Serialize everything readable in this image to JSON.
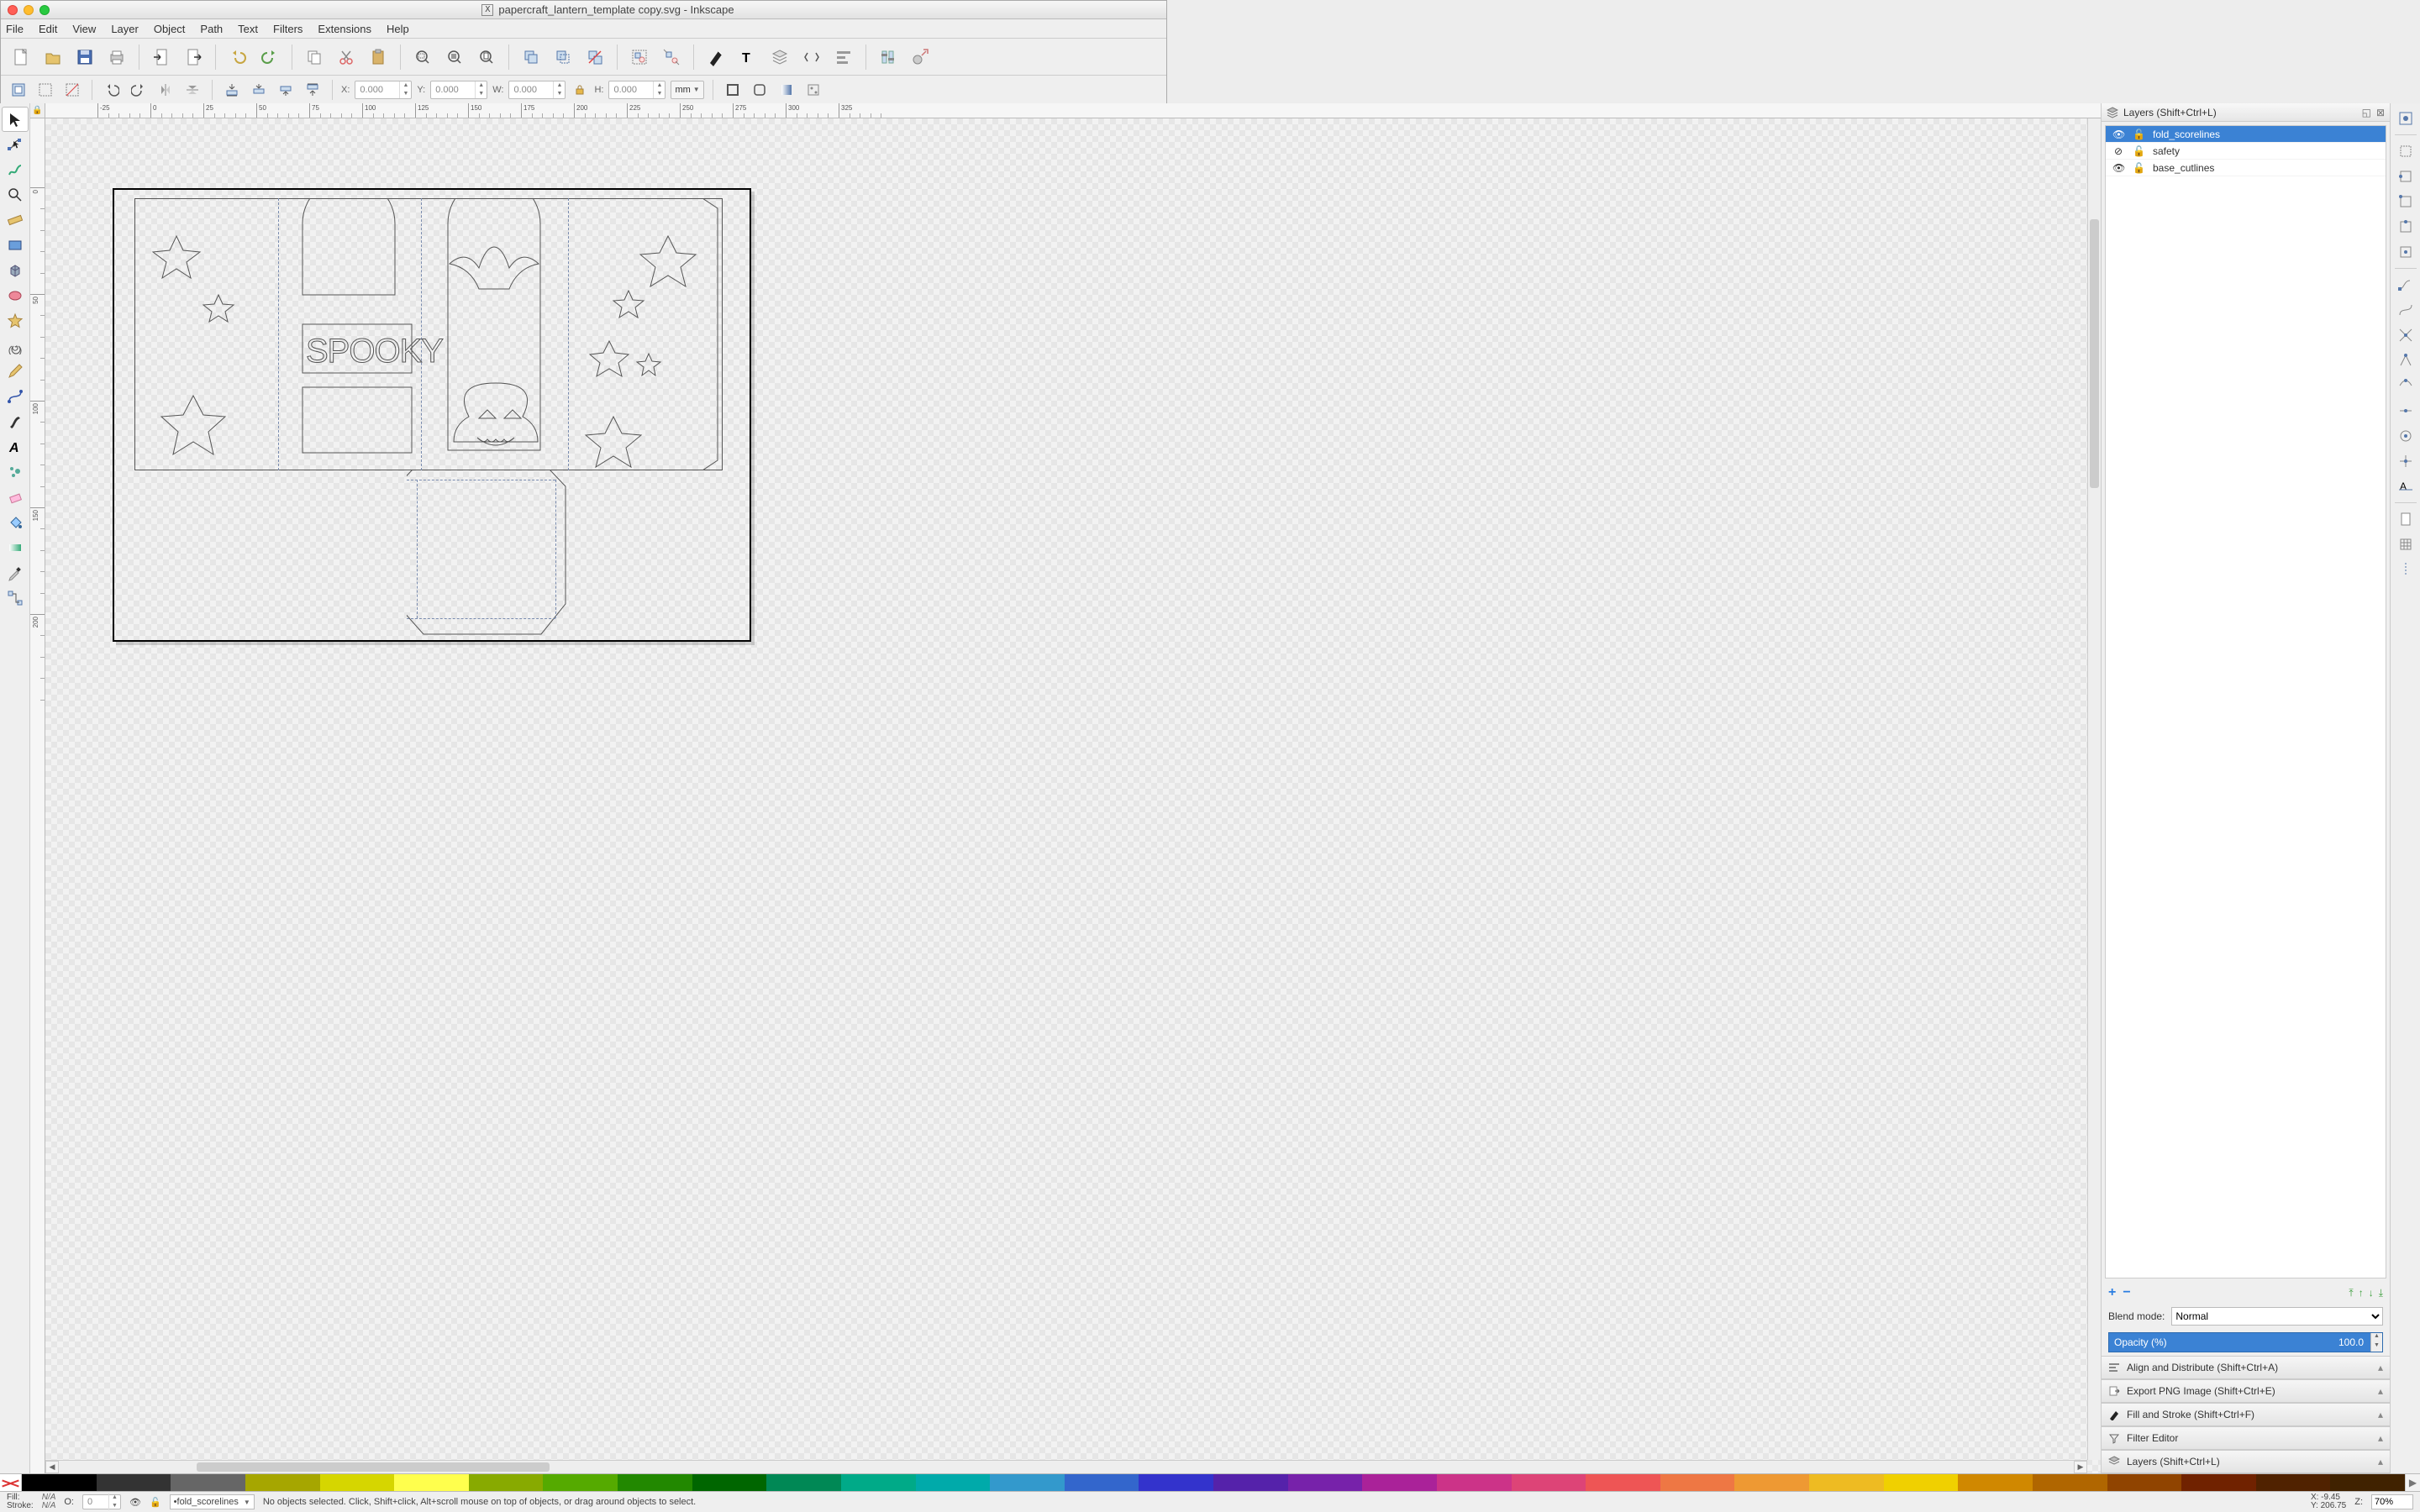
{
  "title": "papercraft_lantern_template copy.svg - Inkscape",
  "menus": [
    "File",
    "Edit",
    "View",
    "Layer",
    "Object",
    "Path",
    "Text",
    "Filters",
    "Extensions",
    "Help"
  ],
  "coords": {
    "x": "0.000",
    "y": "0.000",
    "w": "0.000",
    "h": "0.000",
    "unit": "mm"
  },
  "layers_panel": {
    "title": "Layers (Shift+Ctrl+L)",
    "items": [
      {
        "name": "fold_scorelines",
        "visible": true,
        "locked": false,
        "selected": true
      },
      {
        "name": "safety",
        "visible": false,
        "locked": false,
        "selected": false
      },
      {
        "name": "base_cutlines",
        "visible": true,
        "locked": false,
        "selected": false
      }
    ],
    "blend_label": "Blend mode:",
    "blend_value": "Normal",
    "opacity_label": "Opacity (%)",
    "opacity_value": "100.0"
  },
  "panels": [
    {
      "label": "Align and Distribute (Shift+Ctrl+A)"
    },
    {
      "label": "Export PNG Image (Shift+Ctrl+E)"
    },
    {
      "label": "Fill and Stroke (Shift+Ctrl+F)"
    },
    {
      "label": "Filter Editor"
    },
    {
      "label": "Layers (Shift+Ctrl+L)"
    }
  ],
  "status": {
    "fill_label": "Fill:",
    "stroke_label": "Stroke:",
    "fill_value": "N/A",
    "stroke_value": "N/A",
    "o_label": "O:",
    "o_value": "0",
    "layer_current": "•fold_scorelines",
    "hint": "No objects selected. Click, Shift+click, Alt+scroll mouse on top of objects, or drag around objects to select.",
    "cursor_x_label": "X:",
    "cursor_x": "-9.45",
    "cursor_y_label": "Y:",
    "cursor_y": "206.75",
    "z_label": "Z:",
    "zoom": "70%"
  },
  "palette_colors": [
    "#000000",
    "#333333",
    "#666666",
    "#a6a600",
    "#d6d600",
    "#ffff4d",
    "#88aa00",
    "#55aa00",
    "#228800",
    "#006600",
    "#008855",
    "#00aa88",
    "#00aaaa",
    "#3399cc",
    "#3366cc",
    "#3333cc",
    "#5522aa",
    "#7722aa",
    "#aa2299",
    "#cc3388",
    "#dd4477",
    "#ee5555",
    "#ee7744",
    "#ee9933",
    "#eebb22",
    "#f0d000",
    "#d08800",
    "#b06600",
    "#904400",
    "#702200",
    "#502200",
    "#402200"
  ],
  "labels": {
    "x": "X:",
    "y": "Y:",
    "w": "W:",
    "h": "H:"
  },
  "artwork_text": "SPOOKY"
}
